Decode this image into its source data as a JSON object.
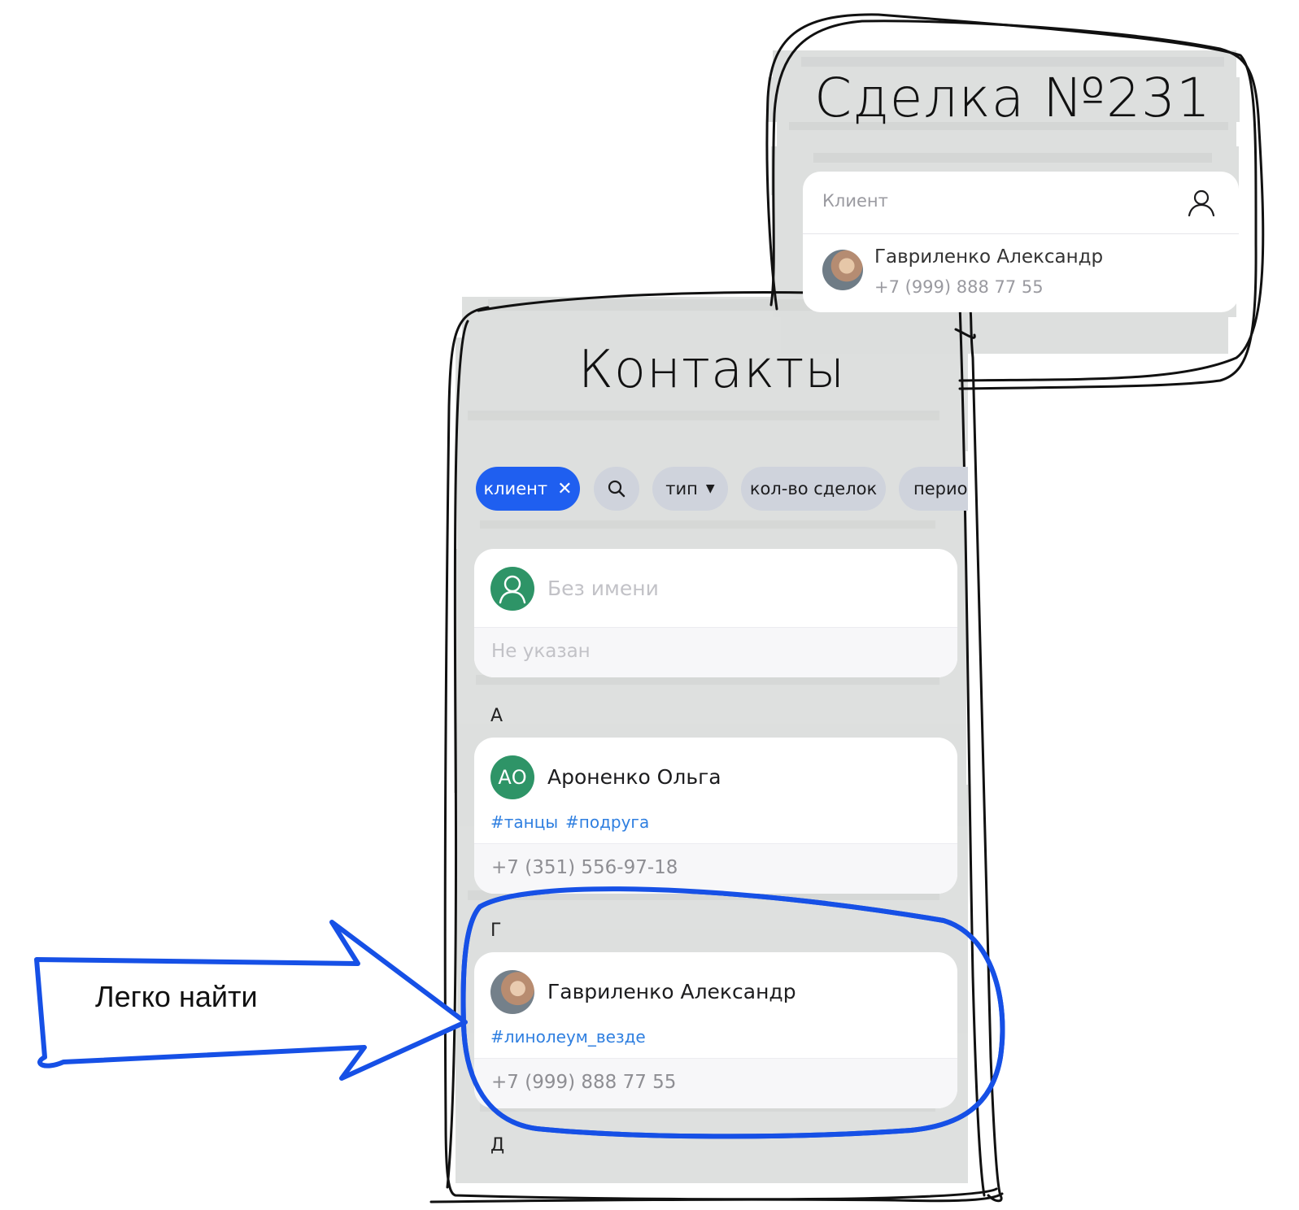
{
  "deal": {
    "title": "Сделка №231",
    "client_label": "Клиент",
    "client_name": "Гавриленко Александр",
    "client_phone": "+7 (999) 888 77 55"
  },
  "contacts": {
    "title": "Контакты",
    "filters": [
      {
        "label": "клиент",
        "active": true
      },
      {
        "label": "",
        "icon": "search-icon"
      },
      {
        "label": "тип",
        "icon": "caret-down-icon"
      },
      {
        "label": "кол-во сделок"
      },
      {
        "label": "перио"
      }
    ],
    "unnamed": {
      "name_placeholder": "Без имени",
      "phone_placeholder": "Не указан"
    },
    "sections": [
      {
        "letter": "А",
        "contact": {
          "initials": "АО",
          "name": "Ароненко Ольга",
          "tags": [
            "#танцы",
            "#подруга"
          ],
          "phone": "+7 (351) 556-97-18"
        }
      },
      {
        "letter": "Г",
        "contact": {
          "name": "Гавриленко Александр",
          "tags": [
            "#линолеум_везде"
          ],
          "phone": "+7 (999) 888 77 55"
        }
      },
      {
        "letter": "Д"
      }
    ]
  },
  "annotation": {
    "callout": "Легко найти"
  },
  "colors": {
    "accent": "#1f5ff0",
    "tag": "#2f7fe0",
    "avatar_green": "#2e9467",
    "sketch_gray": "#dcdedd",
    "annotation_blue": "#1650e6"
  }
}
